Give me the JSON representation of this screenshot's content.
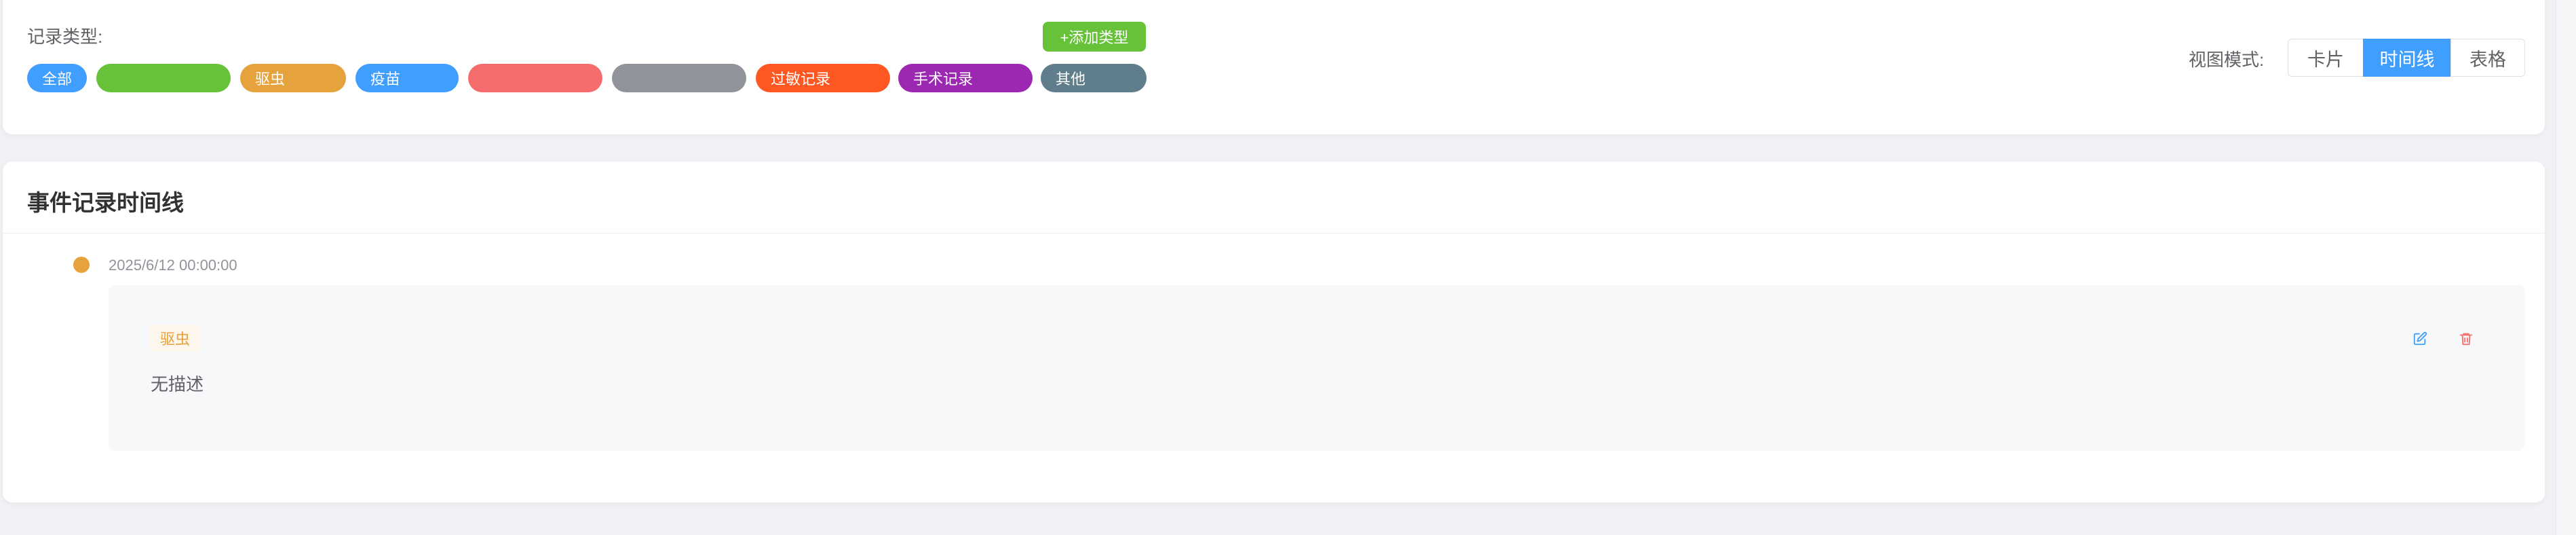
{
  "filter": {
    "label": "记录类型:",
    "add_type_label": "+添加类型",
    "tags": [
      {
        "label": "全部",
        "color": "#409eff"
      },
      {
        "label": "",
        "color": "#67c23a"
      },
      {
        "label": "驱虫",
        "color": "#e6a23c"
      },
      {
        "label": "疫苗",
        "color": "#409eff"
      },
      {
        "label": "",
        "color": "#f56c6c"
      },
      {
        "label": "",
        "color": "#909399"
      },
      {
        "label": "过敏记录",
        "color": "#ff5722"
      },
      {
        "label": "手术记录",
        "color": "#9c27b0"
      },
      {
        "label": "其他",
        "color": "#607d8b"
      }
    ]
  },
  "view": {
    "label": "视图模式:",
    "options": [
      {
        "label": "卡片",
        "active": false
      },
      {
        "label": "时间线",
        "active": true
      },
      {
        "label": "表格",
        "active": false
      }
    ]
  },
  "timeline": {
    "title": "事件记录时间线",
    "events": [
      {
        "time": "2025/6/12 00:00:00",
        "type": "驱虫",
        "dot_color": "#e6a23c",
        "description": "无描述"
      }
    ]
  },
  "icons": {
    "edit": "edit-icon",
    "delete": "delete-icon",
    "edit_color": "#409eff",
    "delete_color": "#f56c6c"
  }
}
